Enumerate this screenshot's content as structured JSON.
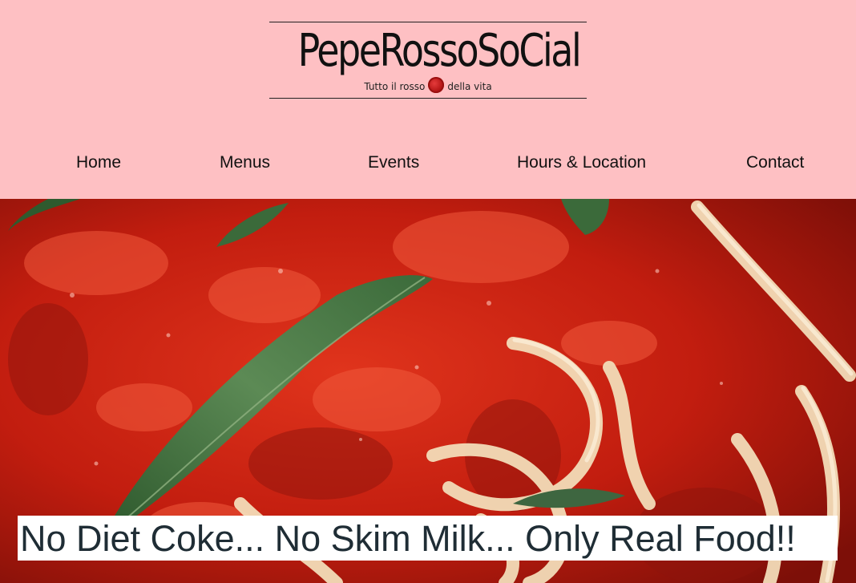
{
  "brand": {
    "name": "PepeRossoSoCial",
    "tagline_left": "Tutto il rosso",
    "tagline_right": "della vita",
    "badge_icon": "chili-badge-icon",
    "background_color": "#fec0c3"
  },
  "nav": {
    "items": [
      {
        "label": "Home"
      },
      {
        "label": "Menus"
      },
      {
        "label": "Events"
      },
      {
        "label": "Hours & Location"
      },
      {
        "label": "Contact"
      }
    ]
  },
  "hero": {
    "caption": "No Diet Coke... No Skim Milk... Only Real Food!!"
  },
  "colors": {
    "caption_text": "#1f2d35",
    "sauce": "#c41e10",
    "basil": "#3f6b3a",
    "pasta": "#f3dcb8"
  }
}
